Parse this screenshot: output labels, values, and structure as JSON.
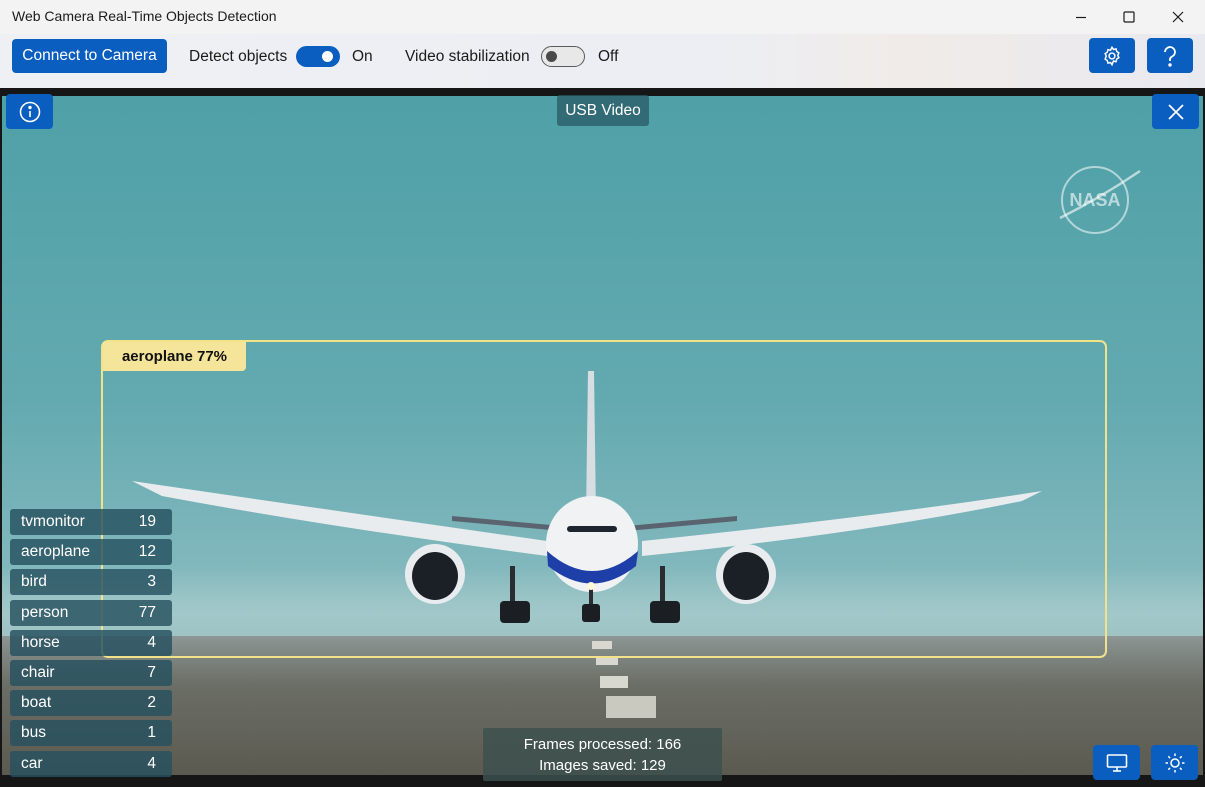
{
  "window": {
    "title": "Web Camera Real-Time Objects Detection",
    "controls": [
      "minimize-icon",
      "maximize-icon",
      "close-icon"
    ]
  },
  "toolbar": {
    "connect_label": "Connect to Camera",
    "detect_label": "Detect objects",
    "detect_state": "On",
    "detect_enabled": true,
    "stabilization_label": "Video stabilization",
    "stabilization_state": "Off",
    "stabilization_enabled": false,
    "settings_icon": "gear-icon",
    "help_icon": "question-icon",
    "accent": "#0a5ebf"
  },
  "video": {
    "camera_label": "USB Video",
    "info_icon": "info-icon",
    "close_icon": "close-icon",
    "watermark": "NASA",
    "detection": {
      "label": "aeroplane 77%",
      "color": "#f2e28a"
    },
    "counts": [
      {
        "name": "tvmonitor",
        "count": "19"
      },
      {
        "name": "aeroplane",
        "count": "12"
      },
      {
        "name": "bird",
        "count": "3"
      },
      {
        "name": "person",
        "count": "77"
      },
      {
        "name": "horse",
        "count": "4"
      },
      {
        "name": "chair",
        "count": "7"
      },
      {
        "name": "boat",
        "count": "2"
      },
      {
        "name": "bus",
        "count": "1"
      },
      {
        "name": "car",
        "count": "4"
      }
    ],
    "stats": {
      "frames": "Frames processed: 166",
      "images": "Images saved: 129"
    },
    "bottom_buttons": [
      "monitor-icon",
      "brightness-icon"
    ]
  }
}
